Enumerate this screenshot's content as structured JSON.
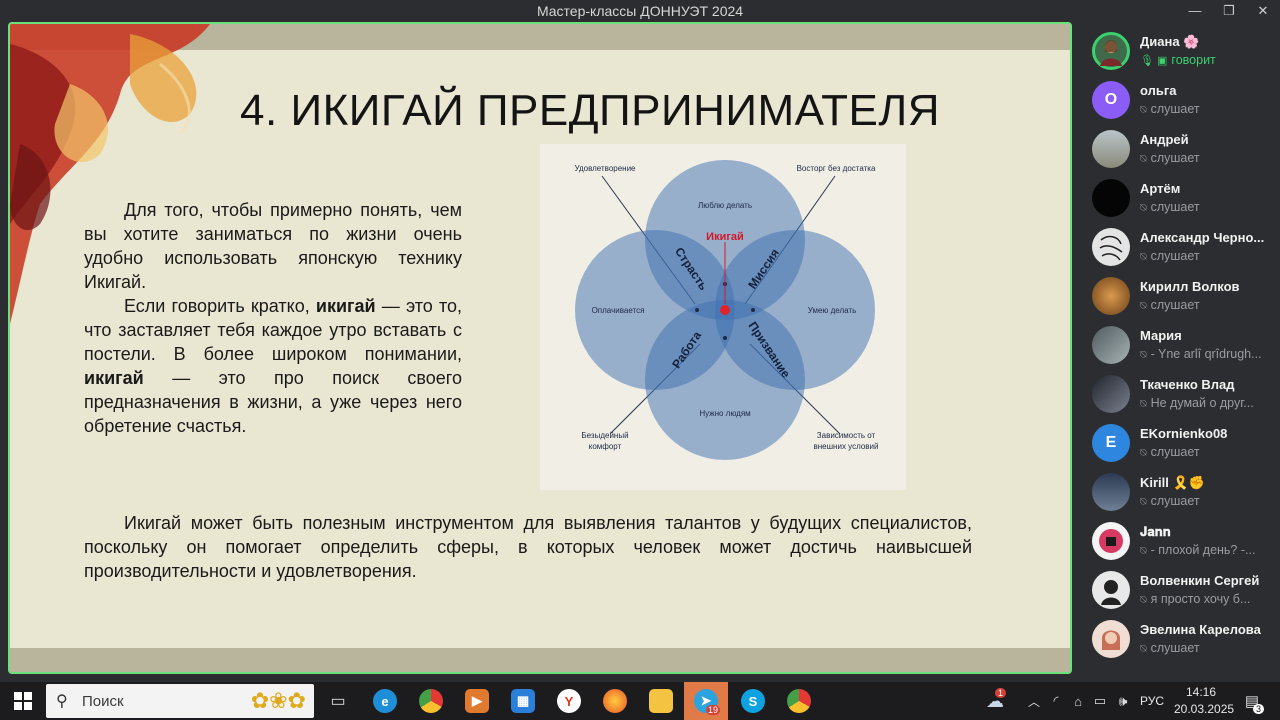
{
  "window": {
    "title": "Мастер-классы ДОННУЭТ 2024",
    "controls": [
      "—",
      "❐",
      "✕"
    ]
  },
  "slide": {
    "title": "4. ИКИГАЙ ПРЕДПРИНИМАТЕЛЯ",
    "para1_a": "Для того, чтобы примерно понять, чем вы хотите заниматься по жизни очень удобно использовать японскую технику Икигай.",
    "para2_pre": "Если говорить кратко, ",
    "para2_bold1": "икигай",
    "para2_mid": " — это то, что заставляет тебя каждое утро вставать с постели. В более широком понимании, ",
    "para2_bold2": "икигай",
    "para2_post": " — это про поиск своего предназначения в жизни, а уже через него обретение счастья.",
    "bottom_text": "Икигай может быть полезным инструментом для выявления талантов у будущих специалистов, поскольку он помогает определить сферы, в которых человек может достичь наивысшей производительности и удовлетворения.",
    "diagram": {
      "center": "Икигай",
      "top": "Люблю делать",
      "left": "Оплачивается",
      "right": "Умею делать",
      "bottom": "Нужно людям",
      "passion": "Страсть",
      "mission": "Миссия",
      "profession": "Работа",
      "vocation": "Призвание",
      "corner_tl": "Удовлетворение",
      "corner_tr": "Восторг без достатка",
      "corner_bl1": "Безыдейный",
      "corner_bl2": "комфорт",
      "corner_br1": "Зависимость от",
      "corner_br2": "внешних условий",
      "colors": {
        "circle": "#3d6fb0",
        "center_dot": "#e0232b",
        "accent_text": "#d3182a"
      }
    }
  },
  "participants": [
    {
      "name": "Диана 🌸",
      "status": "говорит",
      "avatar": "photo",
      "color": "#3f6b4a",
      "speaking": true
    },
    {
      "name": "ольга",
      "status": "слушает",
      "avatar": "О",
      "color": "#8b5cf6"
    },
    {
      "name": "Андрей",
      "status": "слушает",
      "avatar": "photo",
      "color": "#9aa3a8"
    },
    {
      "name": "Артём",
      "status": "слушает",
      "avatar": "photo",
      "color": "#050505"
    },
    {
      "name": "Александр Черно...",
      "status": "слушает",
      "avatar": "photo",
      "color": "#d9d9d9"
    },
    {
      "name": "Кирилл Волков",
      "status": "слушает",
      "avatar": "photo",
      "color": "#a36a2c"
    },
    {
      "name": "Мария",
      "status": "- Yne arlî qrîdrugh...",
      "avatar": "photo",
      "color": "#6c7a80"
    },
    {
      "name": "Ткаченко Влад",
      "status": "Не думай о друг...",
      "avatar": "photo",
      "color": "#3a3f4a"
    },
    {
      "name": "EKornienko08",
      "status": "слушает",
      "avatar": "E",
      "color": "#2f86de"
    },
    {
      "name": "Kirill 🎗️✊",
      "status": "слушает",
      "avatar": "photo",
      "color": "#3d4f66"
    },
    {
      "name": "𝐉𝐚𝐧𝐧",
      "status": "- плохой день? -...",
      "avatar": "photo",
      "color": "#d63a62"
    },
    {
      "name": "Волвенкин Сергей",
      "status": "я просто хочу б...",
      "avatar": "photo",
      "color": "#e8e8e8"
    },
    {
      "name": "Эвелина Карелова",
      "status": "слушает",
      "avatar": "photo",
      "color": "#c96f58"
    }
  ],
  "taskbar": {
    "search_placeholder": "Поиск",
    "lang": "РУС",
    "time": "14:16",
    "date": "20.03.2025",
    "notif_count": "3",
    "weather_badge": "1",
    "telegram_badge": "19"
  }
}
